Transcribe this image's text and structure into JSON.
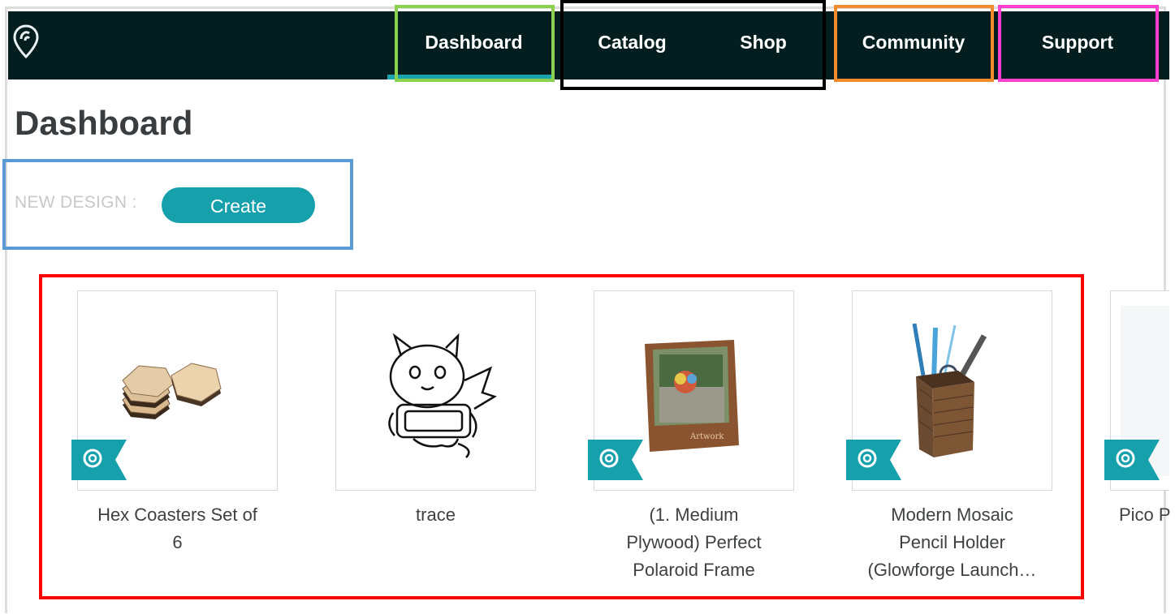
{
  "nav": {
    "items": [
      {
        "label": "Dashboard"
      },
      {
        "label": "Catalog"
      },
      {
        "label": "Shop"
      },
      {
        "label": "Community"
      },
      {
        "label": "Support"
      }
    ]
  },
  "page": {
    "title": "Dashboard"
  },
  "new_design": {
    "label": "NEW DESIGN :",
    "create_label": "Create"
  },
  "designs": [
    {
      "title_line1": "Hex Coasters Set of",
      "title_line2": "6",
      "title_line3": "",
      "badge": "glowforge-ribbon-icon"
    },
    {
      "title_line1": "trace",
      "title_line2": "",
      "title_line3": ""
    },
    {
      "title_line1": "(1. Medium",
      "title_line2": "Plywood) Perfect",
      "title_line3": "Polaroid Frame",
      "badge": "glowforge-ribbon-icon"
    },
    {
      "title_line1": "Modern Mosaic",
      "title_line2": "Pencil Holder",
      "title_line3": "(Glowforge Launch…",
      "badge": "glowforge-ribbon-icon"
    },
    {
      "title_line1": "Pico P",
      "title_line2": "",
      "title_line3": "",
      "badge": "glowforge-ribbon-icon"
    }
  ],
  "colors": {
    "topbar": "#041e20",
    "accent": "#15a0ab",
    "highlight_dashboard": "#8bd14f",
    "highlight_catalog_shop": "#000000",
    "highlight_community": "#f28a2e",
    "highlight_support": "#ff3fd0",
    "highlight_new_design": "#5b9bd5",
    "highlight_cards": "#ff0000"
  }
}
